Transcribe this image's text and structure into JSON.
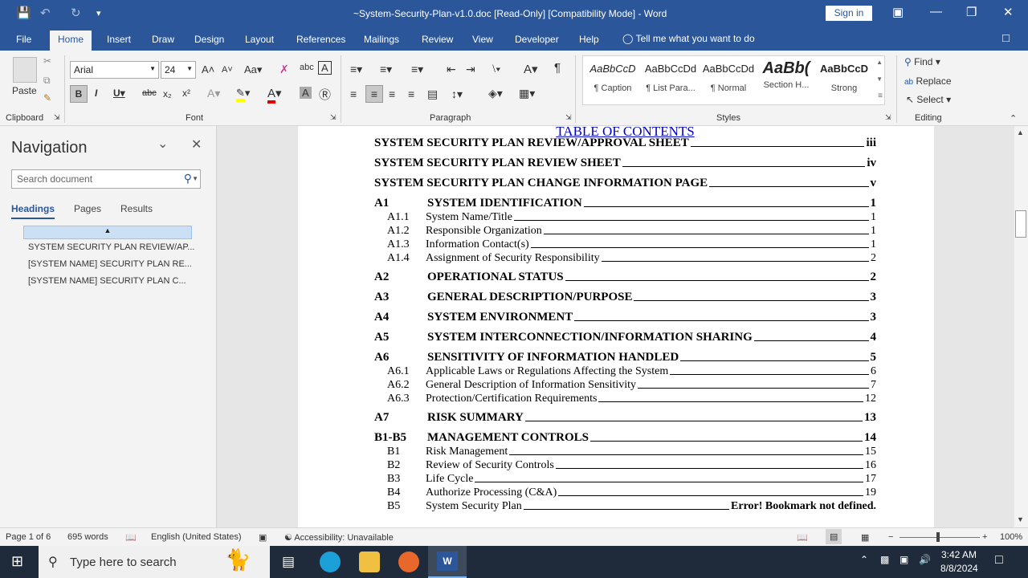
{
  "window": {
    "title": "~System-Security-Plan-v1.0.doc [Read-Only] [Compatibility Mode]  -  Word",
    "signin": "Sign in"
  },
  "menu": {
    "tabs": [
      "File",
      "Home",
      "Insert",
      "Draw",
      "Design",
      "Layout",
      "References",
      "Mailings",
      "Review",
      "View",
      "Developer",
      "Help"
    ],
    "active": "Home",
    "tell": "Tell me what you want to do"
  },
  "ribbon": {
    "groups": {
      "clipboard": "Clipboard",
      "font": "Font",
      "paragraph": "Paragraph",
      "styles": "Styles",
      "editing": "Editing"
    },
    "paste": "Paste",
    "font_name": "Arial",
    "font_size": "24",
    "styles": [
      {
        "preview": "AaBbCcD",
        "name": "¶ Caption"
      },
      {
        "preview": "AaBbCcDd",
        "name": "¶ List Para..."
      },
      {
        "preview": "AaBbCcDd",
        "name": "¶ Normal"
      },
      {
        "preview": "AaBb(",
        "name": "Section H..."
      },
      {
        "preview": "AaBbCcD",
        "name": "Strong"
      }
    ],
    "find": "Find",
    "replace": "Replace",
    "select": "Select"
  },
  "navigation": {
    "title": "Navigation",
    "search_placeholder": "Search document",
    "tabs": [
      "Headings",
      "Pages",
      "Results"
    ],
    "headings": [
      "SYSTEM SECURITY PLAN REVIEW/AP...",
      "[SYSTEM NAME] SECURITY PLAN RE...",
      "[SYSTEM NAME] SECURITY PLAN C..."
    ]
  },
  "document": {
    "toc_title": "TABLE OF CONTENTS",
    "entries": [
      {
        "lvl": "h",
        "num": "",
        "text": "SYSTEM SECURITY PLAN REVIEW/APPROVAL SHEET",
        "page": "iii"
      },
      {
        "lvl": "h",
        "num": "",
        "text": "SYSTEM SECURITY PLAN REVIEW SHEET",
        "page": "iv"
      },
      {
        "lvl": "h",
        "num": "",
        "text": "SYSTEM SECURITY PLAN CHANGE INFORMATION PAGE",
        "page": "v"
      },
      {
        "lvl": "h",
        "num": "A1",
        "text": "SYSTEM IDENTIFICATION",
        "page": "1"
      },
      {
        "lvl": "s",
        "num": "A1.1",
        "text": "System Name/Title",
        "page": "1"
      },
      {
        "lvl": "s",
        "num": "A1.2",
        "text": "Responsible Organization",
        "page": "1"
      },
      {
        "lvl": "s",
        "num": "A1.3",
        "text": "Information Contact(s)",
        "page": "1"
      },
      {
        "lvl": "s",
        "num": "A1.4",
        "text": "Assignment of Security Responsibility",
        "page": "2"
      },
      {
        "lvl": "h",
        "num": "A2",
        "text": "OPERATIONAL STATUS",
        "page": "2"
      },
      {
        "lvl": "h",
        "num": "A3",
        "text": "GENERAL DESCRIPTION/PURPOSE",
        "page": "3"
      },
      {
        "lvl": "h",
        "num": "A4",
        "text": "SYSTEM ENVIRONMENT",
        "page": "3"
      },
      {
        "lvl": "h",
        "num": "A5",
        "text": "SYSTEM INTERCONNECTION/INFORMATION SHARING",
        "page": "4"
      },
      {
        "lvl": "h",
        "num": "A6",
        "text": "SENSITIVITY OF INFORMATION HANDLED",
        "page": "5"
      },
      {
        "lvl": "s",
        "num": "A6.1",
        "text": "Applicable Laws or Regulations Affecting the System",
        "page": "6"
      },
      {
        "lvl": "s",
        "num": "A6.2",
        "text": "General Description of Information Sensitivity",
        "page": "7"
      },
      {
        "lvl": "s",
        "num": "A6.3",
        "text": "Protection/Certification Requirements",
        "page": "12"
      },
      {
        "lvl": "h",
        "num": "A7",
        "text": "RISK SUMMARY",
        "page": "13"
      },
      {
        "lvl": "h",
        "num": "B1-B5",
        "text": "MANAGEMENT CONTROLS",
        "page": "14"
      },
      {
        "lvl": "s",
        "num": "B1",
        "text": "Risk Management",
        "page": "15"
      },
      {
        "lvl": "s",
        "num": "B2",
        "text": "Review of Security Controls",
        "page": "16"
      },
      {
        "lvl": "s",
        "num": "B3",
        "text": "Life Cycle",
        "page": "17"
      },
      {
        "lvl": "s",
        "num": "B4",
        "text": "Authorize Processing (C&A)",
        "page": "19"
      },
      {
        "lvl": "s",
        "num": "B5",
        "text": "System Security Plan",
        "page": "Error! Bookmark not defined."
      }
    ]
  },
  "status": {
    "page": "Page 1 of 6",
    "words": "695 words",
    "language": "English (United States)",
    "accessibility": "Accessibility: Unavailable",
    "zoom": "100%"
  },
  "taskbar": {
    "search": "Type here to search",
    "time": "3:42 AM",
    "date": "8/8/2024"
  }
}
